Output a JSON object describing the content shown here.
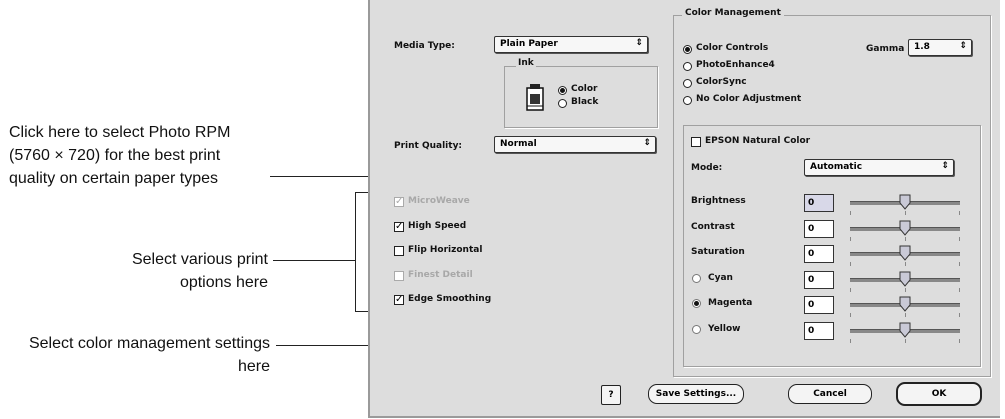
{
  "annotations": [
    "Click here to select Photo RPM (5760 × 720) for the best print quality on certain paper types",
    "Select various print options here",
    "Select color management settings here"
  ],
  "left": {
    "media_type_label": "Media Type:",
    "media_type_value": "Plain Paper",
    "ink_label": "Ink",
    "ink_color": "Color",
    "ink_black": "Black",
    "print_quality_label": "Print Quality:",
    "print_quality_value": "Normal",
    "options": [
      {
        "label": "MicroWeave",
        "checked": true,
        "disabled": true
      },
      {
        "label": "High Speed",
        "checked": true,
        "disabled": false
      },
      {
        "label": "Flip Horizontal",
        "checked": false,
        "disabled": false
      },
      {
        "label": "Finest Detail",
        "checked": false,
        "disabled": true
      },
      {
        "label": "Edge Smoothing",
        "checked": true,
        "disabled": false
      }
    ]
  },
  "color_management": {
    "title": "Color Management",
    "color_controls": "Color Controls",
    "photo_enhance": "PhotoEnhance4",
    "colorsync": "ColorSync",
    "no_color_adjustment": "No Color Adjustment",
    "gamma_label": "Gamma",
    "gamma_value": "1.8",
    "epson_natural_color": "EPSON Natural Color",
    "mode_label": "Mode:",
    "mode_value": "Automatic",
    "adjustments": [
      {
        "label": "Brightness",
        "value": "0",
        "radio": null,
        "level": 0.5
      },
      {
        "label": "Contrast",
        "value": "0",
        "radio": null,
        "level": 0.5
      },
      {
        "label": "Saturation",
        "value": "0",
        "radio": null,
        "level": 0.5
      },
      {
        "label": "Cyan",
        "value": "0",
        "radio": false,
        "level": 0.5
      },
      {
        "label": "Magenta",
        "value": "0",
        "radio": true,
        "level": 0.5
      },
      {
        "label": "Yellow",
        "value": "0",
        "radio": false,
        "level": 0.5
      }
    ]
  },
  "buttons": {
    "help": "?",
    "save_settings": "Save Settings...",
    "cancel": "Cancel",
    "ok": "OK"
  }
}
